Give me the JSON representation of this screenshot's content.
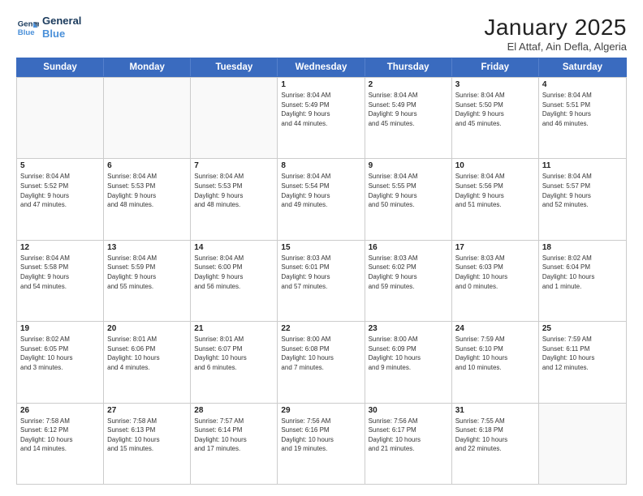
{
  "logo": {
    "line1": "General",
    "line2": "Blue"
  },
  "title": "January 2025",
  "subtitle": "El Attaf, Ain Defla, Algeria",
  "days": [
    "Sunday",
    "Monday",
    "Tuesday",
    "Wednesday",
    "Thursday",
    "Friday",
    "Saturday"
  ],
  "weeks": [
    [
      {
        "day": "",
        "text": "",
        "empty": true
      },
      {
        "day": "",
        "text": "",
        "empty": true
      },
      {
        "day": "",
        "text": "",
        "empty": true
      },
      {
        "day": "1",
        "text": "Sunrise: 8:04 AM\nSunset: 5:49 PM\nDaylight: 9 hours\nand 44 minutes."
      },
      {
        "day": "2",
        "text": "Sunrise: 8:04 AM\nSunset: 5:49 PM\nDaylight: 9 hours\nand 45 minutes."
      },
      {
        "day": "3",
        "text": "Sunrise: 8:04 AM\nSunset: 5:50 PM\nDaylight: 9 hours\nand 45 minutes."
      },
      {
        "day": "4",
        "text": "Sunrise: 8:04 AM\nSunset: 5:51 PM\nDaylight: 9 hours\nand 46 minutes."
      }
    ],
    [
      {
        "day": "5",
        "text": "Sunrise: 8:04 AM\nSunset: 5:52 PM\nDaylight: 9 hours\nand 47 minutes."
      },
      {
        "day": "6",
        "text": "Sunrise: 8:04 AM\nSunset: 5:53 PM\nDaylight: 9 hours\nand 48 minutes."
      },
      {
        "day": "7",
        "text": "Sunrise: 8:04 AM\nSunset: 5:53 PM\nDaylight: 9 hours\nand 48 minutes."
      },
      {
        "day": "8",
        "text": "Sunrise: 8:04 AM\nSunset: 5:54 PM\nDaylight: 9 hours\nand 49 minutes."
      },
      {
        "day": "9",
        "text": "Sunrise: 8:04 AM\nSunset: 5:55 PM\nDaylight: 9 hours\nand 50 minutes."
      },
      {
        "day": "10",
        "text": "Sunrise: 8:04 AM\nSunset: 5:56 PM\nDaylight: 9 hours\nand 51 minutes."
      },
      {
        "day": "11",
        "text": "Sunrise: 8:04 AM\nSunset: 5:57 PM\nDaylight: 9 hours\nand 52 minutes."
      }
    ],
    [
      {
        "day": "12",
        "text": "Sunrise: 8:04 AM\nSunset: 5:58 PM\nDaylight: 9 hours\nand 54 minutes."
      },
      {
        "day": "13",
        "text": "Sunrise: 8:04 AM\nSunset: 5:59 PM\nDaylight: 9 hours\nand 55 minutes."
      },
      {
        "day": "14",
        "text": "Sunrise: 8:04 AM\nSunset: 6:00 PM\nDaylight: 9 hours\nand 56 minutes."
      },
      {
        "day": "15",
        "text": "Sunrise: 8:03 AM\nSunset: 6:01 PM\nDaylight: 9 hours\nand 57 minutes."
      },
      {
        "day": "16",
        "text": "Sunrise: 8:03 AM\nSunset: 6:02 PM\nDaylight: 9 hours\nand 59 minutes."
      },
      {
        "day": "17",
        "text": "Sunrise: 8:03 AM\nSunset: 6:03 PM\nDaylight: 10 hours\nand 0 minutes."
      },
      {
        "day": "18",
        "text": "Sunrise: 8:02 AM\nSunset: 6:04 PM\nDaylight: 10 hours\nand 1 minute."
      }
    ],
    [
      {
        "day": "19",
        "text": "Sunrise: 8:02 AM\nSunset: 6:05 PM\nDaylight: 10 hours\nand 3 minutes."
      },
      {
        "day": "20",
        "text": "Sunrise: 8:01 AM\nSunset: 6:06 PM\nDaylight: 10 hours\nand 4 minutes."
      },
      {
        "day": "21",
        "text": "Sunrise: 8:01 AM\nSunset: 6:07 PM\nDaylight: 10 hours\nand 6 minutes."
      },
      {
        "day": "22",
        "text": "Sunrise: 8:00 AM\nSunset: 6:08 PM\nDaylight: 10 hours\nand 7 minutes."
      },
      {
        "day": "23",
        "text": "Sunrise: 8:00 AM\nSunset: 6:09 PM\nDaylight: 10 hours\nand 9 minutes."
      },
      {
        "day": "24",
        "text": "Sunrise: 7:59 AM\nSunset: 6:10 PM\nDaylight: 10 hours\nand 10 minutes."
      },
      {
        "day": "25",
        "text": "Sunrise: 7:59 AM\nSunset: 6:11 PM\nDaylight: 10 hours\nand 12 minutes."
      }
    ],
    [
      {
        "day": "26",
        "text": "Sunrise: 7:58 AM\nSunset: 6:12 PM\nDaylight: 10 hours\nand 14 minutes."
      },
      {
        "day": "27",
        "text": "Sunrise: 7:58 AM\nSunset: 6:13 PM\nDaylight: 10 hours\nand 15 minutes."
      },
      {
        "day": "28",
        "text": "Sunrise: 7:57 AM\nSunset: 6:14 PM\nDaylight: 10 hours\nand 17 minutes."
      },
      {
        "day": "29",
        "text": "Sunrise: 7:56 AM\nSunset: 6:16 PM\nDaylight: 10 hours\nand 19 minutes."
      },
      {
        "day": "30",
        "text": "Sunrise: 7:56 AM\nSunset: 6:17 PM\nDaylight: 10 hours\nand 21 minutes."
      },
      {
        "day": "31",
        "text": "Sunrise: 7:55 AM\nSunset: 6:18 PM\nDaylight: 10 hours\nand 22 minutes."
      },
      {
        "day": "",
        "text": "",
        "empty": true
      }
    ]
  ]
}
